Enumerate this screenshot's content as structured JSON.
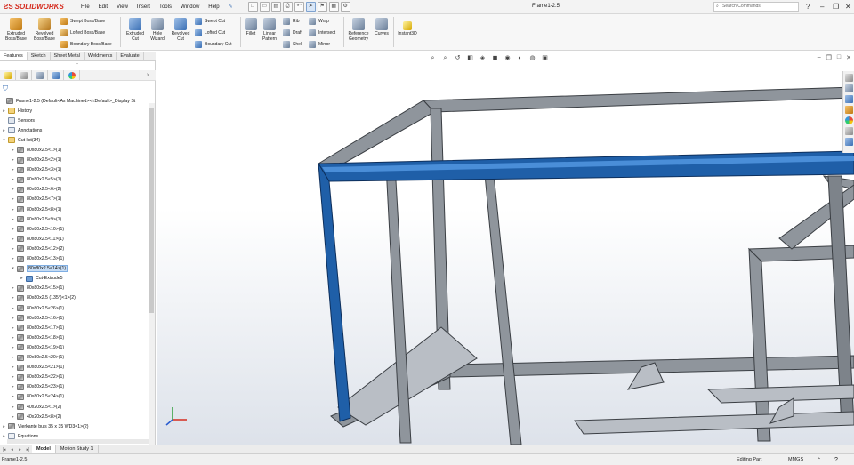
{
  "app": {
    "brand": "SOLIDWORKS",
    "menu": [
      "File",
      "Edit",
      "View",
      "Insert",
      "Tools",
      "Window",
      "Help"
    ],
    "document_title": "Frame1-2.5",
    "search_placeholder": "Search Commands"
  },
  "ribbon": {
    "extruded_boss": "Extruded Boss/Base",
    "revolved_boss": "Revolved Boss/Base",
    "swept_boss": "Swept Boss/Base",
    "lofted_boss": "Lofted Boss/Base",
    "boundary_boss": "Boundary Boss/Base",
    "extruded_cut": "Extruded Cut",
    "hole_wizard": "Hole Wizard",
    "revolved_cut": "Revolved Cut",
    "swept_cut": "Swept Cut",
    "lofted_cut": "Lofted Cut",
    "boundary_cut": "Boundary Cut",
    "fillet": "Fillet",
    "linear_pattern": "Linear Pattern",
    "rib": "Rib",
    "draft": "Draft",
    "shell": "Shell",
    "wrap": "Wrap",
    "intersect": "Intersect",
    "mirror": "Mirror",
    "reference_geometry": "Reference Geometry",
    "curves": "Curves",
    "instant3d": "Instant3D"
  },
  "tabs": [
    "Features",
    "Sketch",
    "Sheet Metal",
    "Weldments",
    "Evaluate"
  ],
  "tree": {
    "root": "Frame1-2.5  (Default<As Machined><<Default>_Display St",
    "items": [
      {
        "label": "History",
        "icon": "folder",
        "exp": "▸"
      },
      {
        "label": "Sensors",
        "icon": "sensor",
        "exp": ""
      },
      {
        "label": "Annotations",
        "icon": "ann",
        "exp": "▸"
      },
      {
        "label": "Cut list(34)",
        "icon": "folder",
        "exp": "▾"
      },
      {
        "label": "80x80x2.5<1>(1)",
        "icon": "beam",
        "exp": "▸"
      },
      {
        "label": "80x80x2.5<2>(1)",
        "icon": "beam",
        "exp": "▸"
      },
      {
        "label": "80x80x2.5<3>(1)",
        "icon": "beam",
        "exp": "▸"
      },
      {
        "label": "80x80x2.5<5>(1)",
        "icon": "beam",
        "exp": "▸"
      },
      {
        "label": "80x80x2.5<6>(2)",
        "icon": "beam",
        "exp": "▸"
      },
      {
        "label": "80x80x2.5<7>(1)",
        "icon": "beam",
        "exp": "▸"
      },
      {
        "label": "80x80x2.5<8>(1)",
        "icon": "beam",
        "exp": "▸"
      },
      {
        "label": "80x80x2.5<9>(1)",
        "icon": "beam",
        "exp": "▸"
      },
      {
        "label": "80x80x2.5<10>(1)",
        "icon": "beam",
        "exp": "▸"
      },
      {
        "label": "80x80x2.5<11>(1)",
        "icon": "beam",
        "exp": "▸"
      },
      {
        "label": "80x80x2.5<12>(2)",
        "icon": "beam",
        "exp": "▸"
      },
      {
        "label": "80x80x2.5<13>(1)",
        "icon": "beam",
        "exp": "▸"
      },
      {
        "label": "80x80x2.5<14>(1)",
        "icon": "beam",
        "exp": "▾",
        "selected": true
      },
      {
        "label": "Cut-Extrude5",
        "icon": "cut",
        "exp": "▸",
        "indent": true
      },
      {
        "label": "80x80x2.5<15>(1)",
        "icon": "beam",
        "exp": "▸"
      },
      {
        "label": "80x80x2.5 (135°)<1>(2)",
        "icon": "beam",
        "exp": "▸"
      },
      {
        "label": "80x80x2.5<26>(1)",
        "icon": "beam",
        "exp": "▸"
      },
      {
        "label": "80x80x2.5<16>(1)",
        "icon": "beam",
        "exp": "▸"
      },
      {
        "label": "80x80x2.5<17>(1)",
        "icon": "beam",
        "exp": "▸"
      },
      {
        "label": "80x80x2.5<18>(1)",
        "icon": "beam",
        "exp": "▸"
      },
      {
        "label": "80x80x2.5<19>(1)",
        "icon": "beam",
        "exp": "▸"
      },
      {
        "label": "80x80x2.5<20>(1)",
        "icon": "beam",
        "exp": "▸"
      },
      {
        "label": "80x80x2.5<21>(1)",
        "icon": "beam",
        "exp": "▸"
      },
      {
        "label": "80x80x2.5<22>(1)",
        "icon": "beam",
        "exp": "▸"
      },
      {
        "label": "80x80x2.5<23>(1)",
        "icon": "beam",
        "exp": "▸"
      },
      {
        "label": "80x80x2.5<24>(1)",
        "icon": "beam",
        "exp": "▸"
      },
      {
        "label": "40x20x2.5<1>(2)",
        "icon": "beam",
        "exp": "▸"
      },
      {
        "label": "40x20x2.5<8>(2)",
        "icon": "beam",
        "exp": "▸"
      },
      {
        "label": "Vierkante buis 35 x 35 WD3<1>(2)",
        "icon": "beam",
        "exp": "▸"
      },
      {
        "label": "Equations",
        "icon": "eq",
        "exp": "▸"
      }
    ]
  },
  "bottom_tabs": [
    "Model",
    "Motion Study 1"
  ],
  "status": {
    "left": "Frame1-2.5",
    "mode": "Editing Part",
    "units": "MMGS"
  },
  "colors": {
    "selection_blue": "#1f5fa8",
    "frame_gray": "#8f959c",
    "frame_edge": "#3b3f44"
  }
}
